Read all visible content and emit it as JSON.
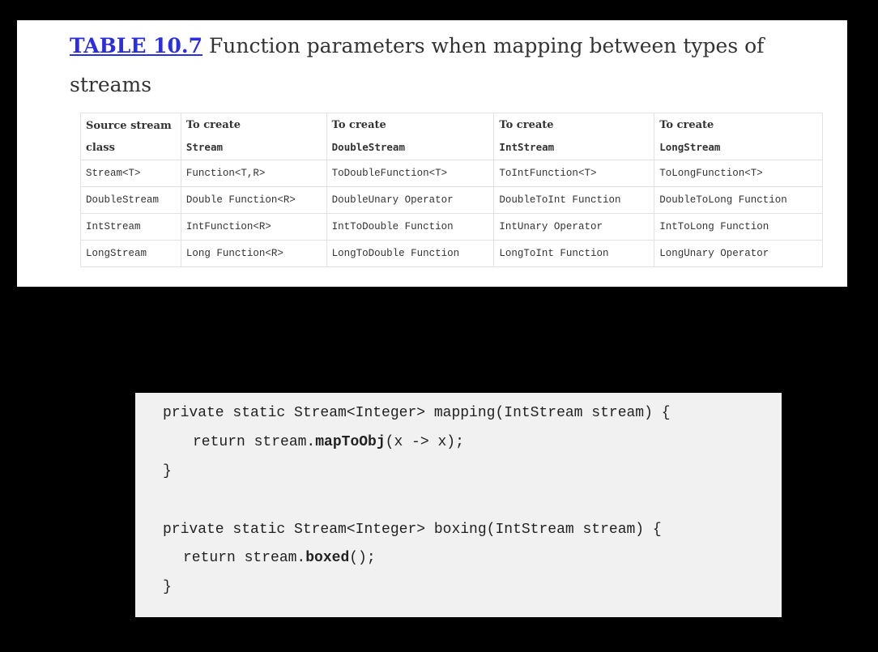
{
  "caption": {
    "ref": "TABLE 10.7",
    "text": " Function parameters when mapping between types of streams"
  },
  "table": {
    "headers": [
      {
        "top": "Source stream",
        "bottom": "class",
        "mono": false
      },
      {
        "top": "To create",
        "bottom": "Stream",
        "mono": true
      },
      {
        "top": "To create",
        "bottom": "DoubleStream",
        "mono": true
      },
      {
        "top": "To create",
        "bottom": "IntStream",
        "mono": true
      },
      {
        "top": "To create",
        "bottom": "LongStream",
        "mono": true
      }
    ],
    "rows": [
      [
        "Stream<T>",
        "Function<T,R>",
        "ToDoubleFunction<T>",
        "ToIntFunction<T>",
        "ToLongFunction<T>"
      ],
      [
        "DoubleStream",
        "Double Function<R>",
        "DoubleUnary Operator",
        "DoubleToInt Function",
        "DoubleToLong Function"
      ],
      [
        "IntStream",
        "IntFunction<R>",
        "IntToDouble Function",
        "IntUnary Operator",
        "IntToLong Function"
      ],
      [
        "LongStream",
        "Long Function<R>",
        "LongToDouble Function",
        "LongToInt Function",
        "LongUnary Operator"
      ]
    ]
  },
  "code": {
    "line1": "private static Stream<Integer> mapping(IntStream stream) {",
    "line2_pre": "return stream.",
    "line2_bold": "mapToObj",
    "line2_post": "(x -> x);",
    "line3": "}",
    "line4": "private static Stream<Integer> boxing(IntStream stream) {",
    "line5_pre": "return stream.",
    "line5_bold": "boxed",
    "line5_post": "();",
    "line6": "}"
  }
}
